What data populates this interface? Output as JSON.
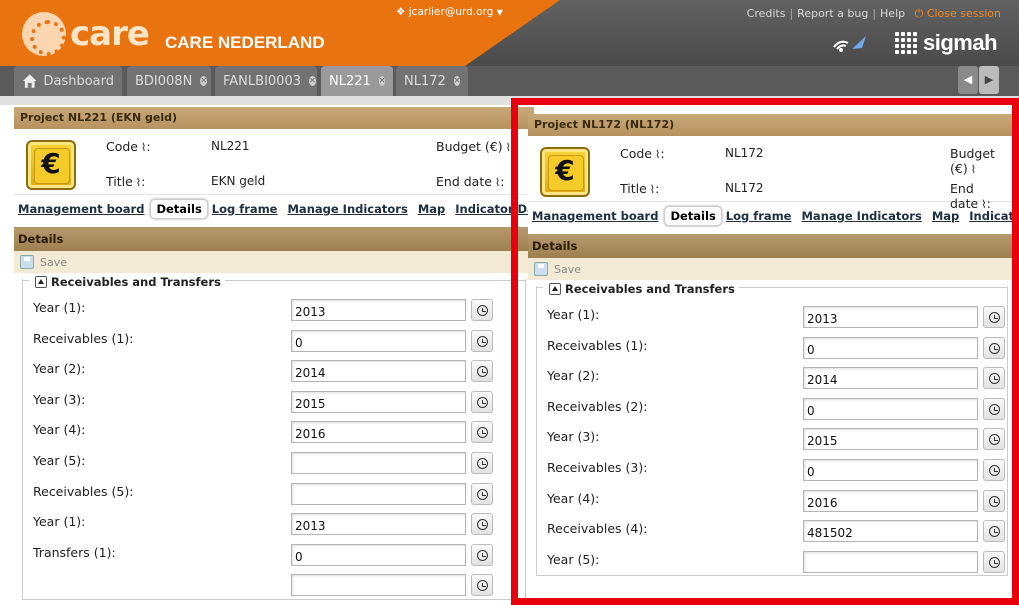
{
  "header": {
    "logo_text": "care",
    "org_name": "CARE NEDERLAND",
    "user": "jcarlier@urd.org",
    "links": {
      "credits": "Credits",
      "report_bug": "Report a bug",
      "help": "Help",
      "close_session": "Close session"
    },
    "brand": "sigmah"
  },
  "tabs": [
    {
      "label": "Dashboard"
    },
    {
      "label": "BDI008N"
    },
    {
      "label": "FANLBI0003"
    },
    {
      "label": "NL221"
    },
    {
      "label": "NL172"
    }
  ],
  "labels": {
    "code": "Code",
    "title": "Title",
    "budget": "Budget (€)",
    "end_date": "End date",
    "details": "Details",
    "save": "Save",
    "fieldset": "Receivables and Transfers"
  },
  "subnav": [
    "Management board",
    "Details",
    "Log frame",
    "Manage Indicators",
    "Map",
    "Indicator Data Entry"
  ],
  "project_left": {
    "title": "Project NL221 (EKN geld)",
    "code": "NL221",
    "name": "EKN geld",
    "fields": [
      {
        "label": "Year (1):",
        "value": "2013"
      },
      {
        "label": "Receivables (1):",
        "value": "0"
      },
      {
        "label": "Year (2):",
        "value": "2014"
      },
      {
        "label": "Year (3):",
        "value": "2015"
      },
      {
        "label": "Year (4):",
        "value": "2016"
      },
      {
        "label": "Year (5):",
        "value": ""
      },
      {
        "label": "Receivables (5):",
        "value": ""
      },
      {
        "label": "Year (1):",
        "value": "2013"
      },
      {
        "label": "Transfers (1):",
        "value": "0"
      },
      {
        "label": "",
        "value": ""
      }
    ]
  },
  "project_right": {
    "title": "Project NL172 (NL172)",
    "code": "NL172",
    "name": "NL172",
    "fields": [
      {
        "label": "Year (1):",
        "value": "2013"
      },
      {
        "label": "Receivables (1):",
        "value": "0"
      },
      {
        "label": "Year (2):",
        "value": "2014"
      },
      {
        "label": "Receivables (2):",
        "value": "0"
      },
      {
        "label": "Year (3):",
        "value": "2015"
      },
      {
        "label": "Receivables (3):",
        "value": "0"
      },
      {
        "label": "Year (4):",
        "value": "2016"
      },
      {
        "label": "Receivables (4):",
        "value": "481502"
      },
      {
        "label": "Year (5):",
        "value": ""
      }
    ]
  }
}
